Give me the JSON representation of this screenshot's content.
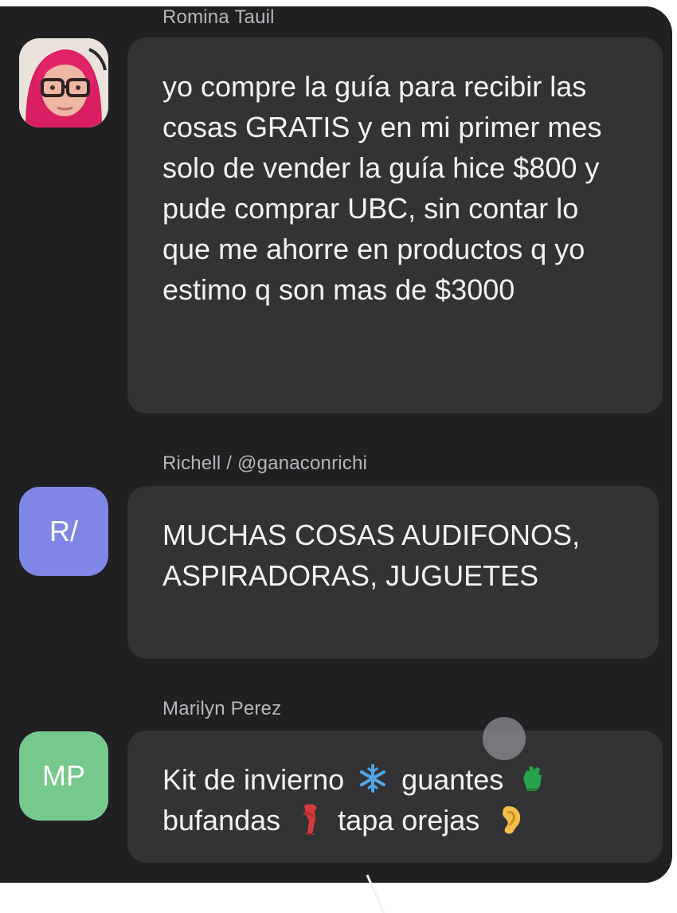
{
  "messages": [
    {
      "sender": "Romina Tauil",
      "avatar_type": "photo",
      "avatar_icon": "user-photo",
      "text": "yo compre la guía para recibir las cosas GRATIS y en mi primer mes solo de vender la guía hice $800 y pude comprar UBC, sin contar lo que me ahorre en productos q yo estimo q son mas de $3000"
    },
    {
      "sender": "Richell / @ganaconrichi",
      "avatar_type": "initials",
      "avatar_text": "R/",
      "avatar_color": "#7f86e6",
      "text": "MUCHAS COSAS AUDIFONOS, ASPIRADORAS, JUGUETES"
    },
    {
      "sender": "Marilyn Perez",
      "avatar_type": "initials",
      "avatar_text": "MP",
      "avatar_color": "#77c98d",
      "text_part1": "Kit de invierno",
      "text_part2": "guantes",
      "text_part3": "bufandas",
      "text_part4": "tapa orejas",
      "emojis": [
        "snowflake-emoji",
        "glove-emoji",
        "scarf-emoji",
        "ear-emoji"
      ]
    }
  ],
  "colors": {
    "panel_background": "#202022",
    "bubble_background": "#333335",
    "sender_text": "#b7b7bb",
    "message_text": "#f3f3f5"
  }
}
